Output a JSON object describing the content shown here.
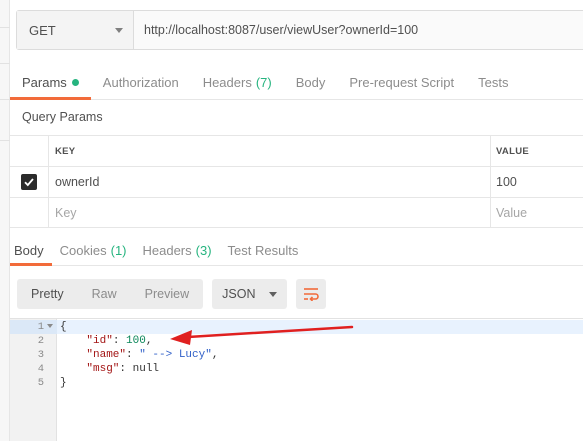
{
  "request": {
    "method": "GET",
    "url": "http://localhost:8087/user/viewUser?ownerId=100"
  },
  "request_tabs": [
    {
      "label": "Params",
      "badge": "",
      "active": true
    },
    {
      "label": "Authorization",
      "badge": ""
    },
    {
      "label": "Headers",
      "badge": "(7)"
    },
    {
      "label": "Body",
      "badge": ""
    },
    {
      "label": "Pre-request Script",
      "badge": ""
    },
    {
      "label": "Tests",
      "badge": ""
    }
  ],
  "query_params": {
    "section_title": "Query Params",
    "headers": {
      "key": "KEY",
      "value": "VALUE"
    },
    "rows": [
      {
        "checked": true,
        "key": "ownerId",
        "value": "100"
      }
    ],
    "placeholders": {
      "key": "Key",
      "value": "Value"
    }
  },
  "response_tabs": [
    {
      "label": "Body",
      "badge": "",
      "active": true
    },
    {
      "label": "Cookies",
      "badge": "(1)"
    },
    {
      "label": "Headers",
      "badge": "(3)"
    },
    {
      "label": "Test Results",
      "badge": ""
    }
  ],
  "format_toolbar": {
    "modes": [
      "Pretty",
      "Raw",
      "Preview"
    ],
    "active_mode": "Pretty",
    "language": "JSON",
    "wrap_icon": "wrap-lines-icon"
  },
  "response_body": {
    "line_numbers": [
      "1",
      "2",
      "3",
      "4",
      "5"
    ],
    "open_brace": "{",
    "close_brace": "}",
    "fields": [
      {
        "key": "\"id\"",
        "value": "100",
        "trail": ","
      },
      {
        "key": "\"name\"",
        "value": "\" --> Lucy\"",
        "trail": ","
      },
      {
        "key": "\"msg\"",
        "value": "null",
        "trail": ""
      }
    ]
  },
  "colors": {
    "accent_orange": "#f26b3a",
    "badge_green": "#26b47f",
    "annotation_red": "#e02020"
  }
}
